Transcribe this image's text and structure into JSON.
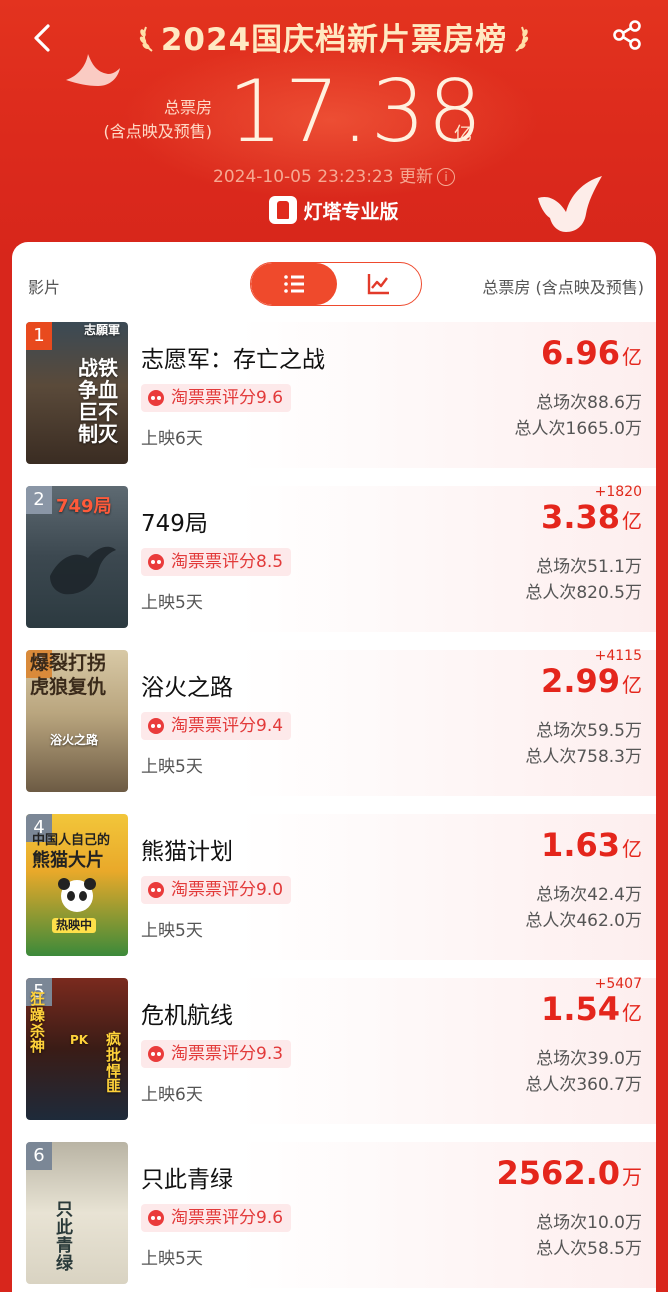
{
  "header": {
    "title": "2024国庆档新片票房榜",
    "total_label_line1": "总票房",
    "total_label_line2": "(含点映及预售)",
    "total_value": "17.38",
    "total_unit": "亿",
    "update_text": "2024-10-05 23:23:23 更新",
    "brand": "灯塔专业版",
    "icons": {
      "back": "chevron-left-icon",
      "share": "share-icon",
      "info": "info-icon"
    }
  },
  "table": {
    "col_film": "影片",
    "col_box": "总票房 (含点映及预售)",
    "view_toggle": {
      "selected": "list",
      "options": [
        "list-icon",
        "trend-chart-icon"
      ]
    }
  },
  "colors": {
    "brand_red": "#e02a1c",
    "accent_orange": "#ef4a2c",
    "value_red": "#e4261c",
    "title_gold": "#ffe9c2"
  },
  "movies": [
    {
      "rank": "1",
      "name": "志愿军：存亡之战",
      "rating": "淘票票评分9.6",
      "days": "上映6天",
      "delta": "",
      "box_value": "6.96",
      "box_unit": "亿",
      "shows": "总场次88.6万",
      "people": "总人次1665.0万",
      "poster_lines": [
        "战铁",
        "争血",
        "巨不",
        "制灭"
      ],
      "poster_top": "志願軍"
    },
    {
      "rank": "2",
      "name": "749局",
      "rating": "淘票票评分8.5",
      "days": "上映5天",
      "delta": "+1820",
      "box_value": "3.38",
      "box_unit": "亿",
      "shows": "总场次51.1万",
      "people": "总人次820.5万",
      "poster_lines": [
        "749局"
      ],
      "poster_top": ""
    },
    {
      "rank": "3",
      "name": "浴火之路",
      "rating": "淘票票评分9.4",
      "days": "上映5天",
      "delta": "+4115",
      "box_value": "2.99",
      "box_unit": "亿",
      "shows": "总场次59.5万",
      "people": "总人次758.3万",
      "poster_lines": [
        "爆裂打拐",
        "虎狼复仇"
      ],
      "poster_top": ""
    },
    {
      "rank": "4",
      "name": "熊猫计划",
      "rating": "淘票票评分9.0",
      "days": "上映5天",
      "delta": "",
      "box_value": "1.63",
      "box_unit": "亿",
      "shows": "总场次42.4万",
      "people": "总人次462.0万",
      "poster_lines": [
        "中国人自己的",
        "熊猫大片"
      ],
      "poster_top": "热映中"
    },
    {
      "rank": "5",
      "name": "危机航线",
      "rating": "淘票票评分9.3",
      "days": "上映6天",
      "delta": "+5407",
      "box_value": "1.54",
      "box_unit": "亿",
      "shows": "总场次39.0万",
      "people": "总人次360.7万",
      "poster_lines": [
        "狂躁杀神",
        "疯批悍匪"
      ],
      "poster_top": "PK"
    },
    {
      "rank": "6",
      "name": "只此青绿",
      "rating": "淘票票评分9.6",
      "days": "上映5天",
      "delta": "",
      "box_value": "2562.0",
      "box_unit": "万",
      "shows": "总场次10.0万",
      "people": "总人次58.5万",
      "poster_lines": [
        "只此青绿"
      ],
      "poster_top": ""
    }
  ]
}
